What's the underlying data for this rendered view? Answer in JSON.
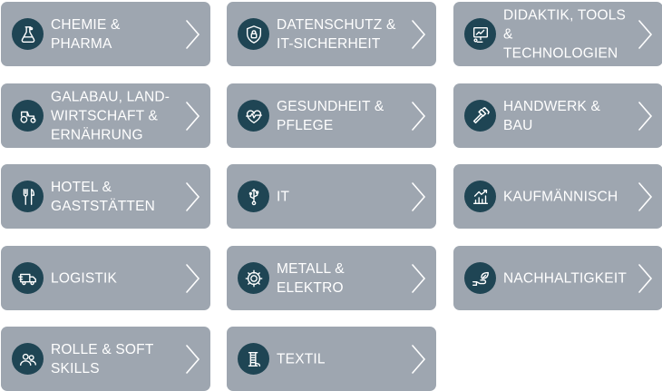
{
  "tiles": [
    {
      "label": "CHEMIE &\nPHARMA",
      "icon": "flask-icon"
    },
    {
      "label": "DATENSCHUTZ &\nIT-SICHERHEIT",
      "icon": "shield-lock-icon"
    },
    {
      "label": "DIDAKTIK, TOOLS\n& TECHNOLOGIEN",
      "icon": "presentation-icon"
    },
    {
      "label": "GALABAU, LAND-\nWIRTSCHAFT &\nERNÄHRUNG",
      "icon": "tractor-icon"
    },
    {
      "label": "GESUNDHEIT &\nPFLEGE",
      "icon": "heartbeat-icon"
    },
    {
      "label": "HANDWERK &\nBAU",
      "icon": "hammer-icon"
    },
    {
      "label": "HOTEL &\nGASTSTÄTTEN",
      "icon": "cutlery-icon"
    },
    {
      "label": "IT",
      "icon": "usb-icon"
    },
    {
      "label": "KAUFMÄNNISCH",
      "icon": "growth-chart-icon"
    },
    {
      "label": "LOGISTIK",
      "icon": "truck-icon"
    },
    {
      "label": "METALL &\nELEKTRO",
      "icon": "gear-icon"
    },
    {
      "label": "NACHHALTIGKEIT",
      "icon": "hand-leaf-icon"
    },
    {
      "label": "ROLLE & SOFT\nSKILLS",
      "icon": "people-icon"
    },
    {
      "label": "TEXTIL",
      "icon": "thread-spool-icon"
    }
  ],
  "colors": {
    "tile_background": "#9ea6b0",
    "icon_circle": "#1f4554",
    "text": "#ffffff"
  }
}
